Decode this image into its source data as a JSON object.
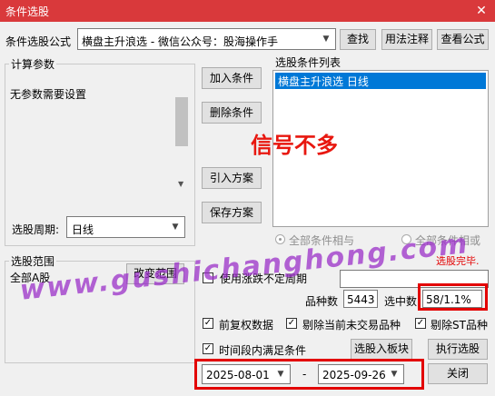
{
  "window": {
    "title": "条件选股",
    "close_label": "✕"
  },
  "formula_row": {
    "label": "条件选股公式",
    "selected_formula": "横盘主升浪选  -  微信公众号：股海操作手",
    "find_button": "查找",
    "usage_button": "用法注释",
    "view_formula_button": "查看公式"
  },
  "params_group": {
    "title": "计算参数",
    "text": "无参数需要设置",
    "period_label": "选股周期:",
    "period_value": "日线"
  },
  "buttons": {
    "add_condition": "加入条件",
    "remove_condition": "删除条件",
    "import_plan": "引入方案",
    "save_plan": "保存方案"
  },
  "conditions_list": {
    "title": "选股条件列表",
    "items": [
      "横盘主升浪选  日线"
    ]
  },
  "overlay_text": "信号不多",
  "logic": {
    "and_label": "全部条件相与",
    "or_label": "全部条件相或"
  },
  "scope_group": {
    "title": "选股范围",
    "value": "全部A股",
    "change_button": "改变范围"
  },
  "status": {
    "done_text": "选股完毕."
  },
  "options": {
    "use_rise_fall_period": "使用涨跌不定周期",
    "prev_adjusted": "前复权数据",
    "exclude_untraded": "剔除当前未交易品种",
    "exclude_st": "剔除ST品种",
    "time_range_condition": "时间段内满足条件"
  },
  "counts": {
    "total_label": "品种数",
    "total_value": "5443",
    "selected_label": "选中数",
    "selected_value": "58/1.1%"
  },
  "actions": {
    "to_block": "选股入板块",
    "execute": "执行选股",
    "close": "关闭"
  },
  "date_range": {
    "start": "2025-08-01",
    "separator": "-",
    "end": "2025-09-26"
  },
  "watermark_text": "www.gushichanghong.com",
  "colors": {
    "title_bar": "#d9393b",
    "highlight": "#0078d7",
    "annotation_red": "#e30000",
    "watermark": "#9b30c9"
  }
}
